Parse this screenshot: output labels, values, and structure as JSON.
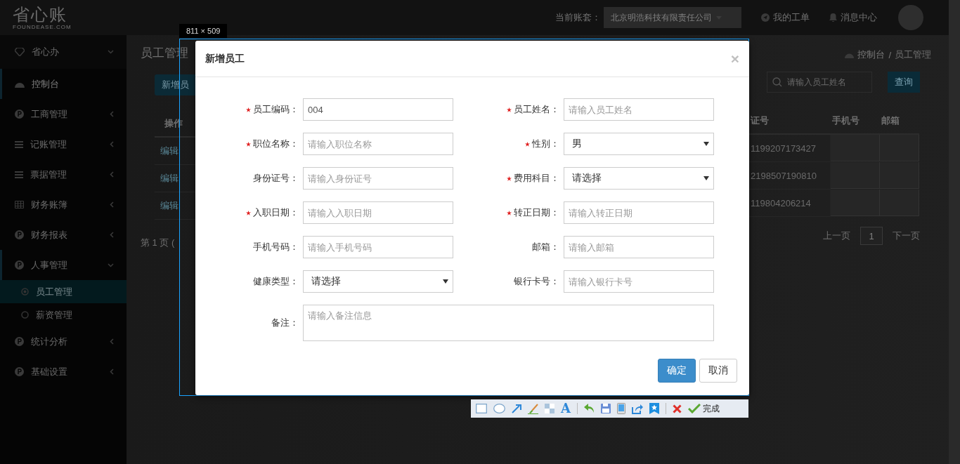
{
  "topbar": {
    "logo": "省心账",
    "logo_sub": "FOUNDEASE.COM",
    "account_label": "当前账套：",
    "account": "北京明浩科技有限责任公司",
    "links": [
      "我的工单",
      "消息中心"
    ]
  },
  "sidebar": {
    "items": [
      {
        "label": "省心办",
        "selected": false,
        "expanded": true
      },
      {
        "label": "控制台",
        "selected": true
      },
      {
        "label": "工商管理",
        "selected": false,
        "expanded": false
      },
      {
        "label": "记账管理",
        "selected": false,
        "expanded": false
      },
      {
        "label": "票据管理",
        "selected": false,
        "expanded": false
      },
      {
        "label": "财务账簿",
        "selected": false,
        "expanded": false
      },
      {
        "label": "财务报表",
        "selected": false,
        "expanded": false
      },
      {
        "label": "人事管理",
        "selected": false,
        "expanded": true,
        "children": [
          {
            "label": "员工管理",
            "selected": true
          },
          {
            "label": "薪资管理",
            "selected": false
          }
        ]
      },
      {
        "label": "统计分析",
        "selected": false,
        "expanded": false
      },
      {
        "label": "基础设置",
        "selected": false,
        "expanded": false
      }
    ]
  },
  "page": {
    "title": "员工管理",
    "breadcrumb": [
      "控制台",
      "员工管理"
    ],
    "breadcrumb_separator": "/",
    "add_button": "新增员",
    "search_placeholder": "请输入员工姓名",
    "search_button": "查询",
    "left_columns": [
      "操作"
    ],
    "right_columns": [
      "证号",
      "手机号",
      "邮箱"
    ],
    "rows": [
      {
        "action": "编辑",
        "id_number": "1199207173427"
      },
      {
        "action": "编辑",
        "id_number": "2198507190810"
      },
      {
        "action": "编辑",
        "id_number": "119804206214"
      }
    ],
    "pager_info": "第 1 页 (",
    "prev": "上一页",
    "current_page": "1",
    "next": "下一页"
  },
  "modal": {
    "title": "新增员工",
    "close": "×",
    "fields": [
      {
        "label": "员工编码：",
        "required": true,
        "kind": "input",
        "value": "004"
      },
      {
        "label": "员工姓名：",
        "required": true,
        "kind": "input",
        "placeholder": "请输入员工姓名"
      },
      {
        "label": "职位名称：",
        "required": true,
        "kind": "input",
        "placeholder": "请输入职位名称"
      },
      {
        "label": "性别：",
        "required": true,
        "kind": "select",
        "value": "男"
      },
      {
        "label": "身份证号：",
        "required": false,
        "kind": "input",
        "placeholder": "请输入身份证号"
      },
      {
        "label": "费用科目：",
        "required": true,
        "kind": "select",
        "value": "请选择"
      },
      {
        "label": "入职日期：",
        "required": true,
        "kind": "input",
        "placeholder": "请输入入职日期"
      },
      {
        "label": "转正日期：",
        "required": true,
        "kind": "input",
        "placeholder": "请输入转正日期"
      },
      {
        "label": "手机号码：",
        "required": false,
        "kind": "input",
        "placeholder": "请输入手机号码"
      },
      {
        "label": "邮箱：",
        "required": false,
        "kind": "input",
        "placeholder": "请输入邮箱"
      },
      {
        "label": "健康类型：",
        "required": false,
        "kind": "select",
        "value": "请选择"
      },
      {
        "label": "银行卡号：",
        "required": false,
        "kind": "input",
        "placeholder": "请输入银行卡号"
      },
      {
        "label": "备注：",
        "required": false,
        "kind": "textarea",
        "placeholder": "请输入备注信息"
      }
    ],
    "buttons": [
      {
        "label": "确定",
        "kind": "primary"
      },
      {
        "label": "取消",
        "kind": "default"
      }
    ]
  },
  "capture": {
    "size": "811 × 509",
    "text_tool": "A",
    "done": "完成"
  }
}
